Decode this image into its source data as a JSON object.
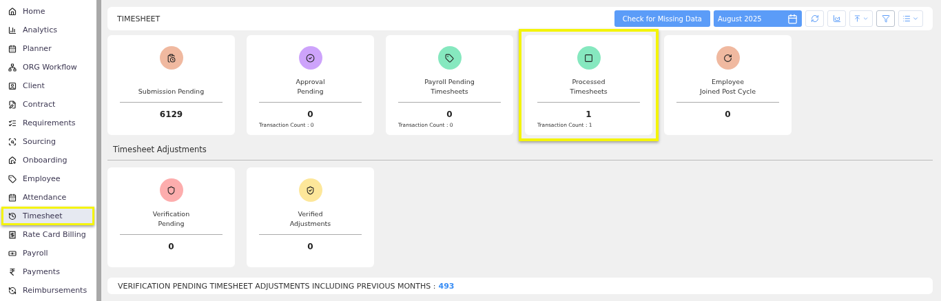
{
  "sidebar": {
    "items": [
      {
        "label": "Home",
        "selected": false,
        "highlighted": false
      },
      {
        "label": "Analytics",
        "selected": false,
        "highlighted": false
      },
      {
        "label": "Planner",
        "selected": false,
        "highlighted": false
      },
      {
        "label": "ORG Workflow",
        "selected": false,
        "highlighted": false
      },
      {
        "label": "Client",
        "selected": false,
        "highlighted": false
      },
      {
        "label": "Contract",
        "selected": false,
        "highlighted": false
      },
      {
        "label": "Requirements",
        "selected": false,
        "highlighted": false
      },
      {
        "label": "Sourcing",
        "selected": false,
        "highlighted": false
      },
      {
        "label": "Onboarding",
        "selected": false,
        "highlighted": false
      },
      {
        "label": "Employee",
        "selected": false,
        "highlighted": false
      },
      {
        "label": "Attendance",
        "selected": false,
        "highlighted": false
      },
      {
        "label": "Timesheet",
        "selected": true,
        "highlighted": true
      },
      {
        "label": "Rate Card Billing",
        "selected": false,
        "highlighted": false
      },
      {
        "label": "Payroll",
        "selected": false,
        "highlighted": false
      },
      {
        "label": "Payments",
        "selected": false,
        "highlighted": false
      },
      {
        "label": "Reimbursements",
        "selected": false,
        "highlighted": false
      }
    ]
  },
  "header": {
    "title": "TIMESHEET",
    "check_button": "Check for Missing Data",
    "month": "August 2025"
  },
  "cards": [
    {
      "title": [
        "Submission Pending"
      ],
      "value": "6129",
      "color": "#f0b9a0",
      "highlighted": false
    },
    {
      "title": [
        "Approval",
        "Pending"
      ],
      "value": "0",
      "count": "Transaction Count : 0",
      "color": "#cda3fb",
      "highlighted": false
    },
    {
      "title": [
        "Payroll Pending",
        "Timesheets"
      ],
      "value": "0",
      "count": "Transaction Count : 0",
      "color": "#86e8bf",
      "highlighted": false
    },
    {
      "title": [
        "Processed",
        "Timesheets"
      ],
      "value": "1",
      "count": "Transaction Count : 1",
      "color": "#86e8bf",
      "highlighted": true
    },
    {
      "title": [
        "Employee",
        "Joined Post Cycle"
      ],
      "value": "0",
      "color": "#f0b9a0",
      "highlighted": false
    }
  ],
  "adjustments": {
    "heading": "Timesheet Adjustments",
    "cards": [
      {
        "title": [
          "Verification",
          "Pending"
        ],
        "value": "0",
        "color": "#fdadad",
        "highlighted": false
      },
      {
        "title": [
          "Verified",
          "Adjustments"
        ],
        "value": "0",
        "color": "#fde79a",
        "highlighted": false
      }
    ]
  },
  "footer": {
    "label": "VERIFICATION PENDING TIMESHEET ADJUSTMENTS INCLUDING PREVIOUS MONTHS :",
    "value": "493"
  }
}
